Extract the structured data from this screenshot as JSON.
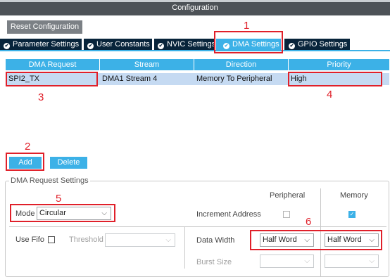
{
  "window": {
    "title": "Configuration"
  },
  "toolbar": {
    "reset_label": "Reset Configuration"
  },
  "tabs": [
    {
      "label": "Parameter Settings",
      "active": false
    },
    {
      "label": "User Constants",
      "active": false
    },
    {
      "label": "NVIC Settings",
      "active": false
    },
    {
      "label": "DMA Settings",
      "active": true
    },
    {
      "label": "GPIO Settings",
      "active": false
    }
  ],
  "table": {
    "columns": [
      "DMA Request",
      "Stream",
      "Direction",
      "Priority"
    ],
    "rows": [
      {
        "request": "SPI2_TX",
        "stream": "DMA1 Stream 4",
        "direction": "Memory To Peripheral",
        "priority": "High"
      }
    ]
  },
  "actions": {
    "add_label": "Add",
    "delete_label": "Delete"
  },
  "settings": {
    "legend": "DMA Request Settings",
    "peripheral_header": "Peripheral",
    "memory_header": "Memory",
    "mode_label": "Mode",
    "mode_value": "Circular",
    "increment_label": "Increment Address",
    "increment_peripheral": false,
    "increment_memory": true,
    "fifo_label": "Use Fifo",
    "use_fifo": false,
    "threshold_label": "Threshold",
    "threshold_value": "",
    "data_width_label": "Data Width",
    "data_width_peripheral": "Half Word",
    "data_width_memory": "Half Word",
    "burst_label": "Burst Size",
    "burst_peripheral": "",
    "burst_memory": ""
  },
  "annotations": [
    "1",
    "2",
    "3",
    "4",
    "5",
    "6"
  ],
  "colors": {
    "accent": "#3cb1e7",
    "tab_dark": "#08243b",
    "title_bar": "#4d5257",
    "selected_row": "#c5daf2",
    "annotation_red": "#e0202a"
  },
  "icons": {
    "tab_status": "check-circle-icon",
    "dropdown": "chevron-down-icon",
    "checkbox": "checkbox-icon"
  }
}
